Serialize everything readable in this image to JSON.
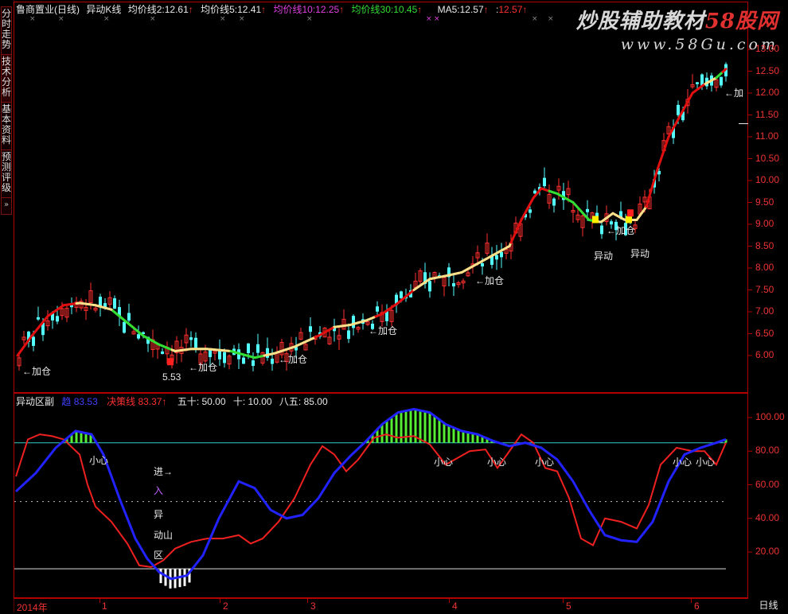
{
  "left_tabs": [
    {
      "label": "分时走势",
      "active": false
    },
    {
      "label": "技术分析",
      "active": true
    },
    {
      "label": "基本资料",
      "active": false
    },
    {
      "label": "预测评级",
      "active": false
    },
    {
      "label": "»",
      "active": false
    }
  ],
  "header": {
    "stock": "鲁商置业(日线)",
    "indicator": "异动K线",
    "ma2_label": "均价线2:",
    "ma2_value": "12.61",
    "ma5_label": "均价线5:",
    "ma5_value": "12.41",
    "ma10_label": "均价线10:",
    "ma10_value": "12.25",
    "ma30_label": "均价线30:",
    "ma30_value": "10.45",
    "ma5b_label": "MA5:",
    "ma5b_value": "12.57",
    "extra_value": "12.57",
    "arrow_glyph": "↑"
  },
  "watermark": {
    "line1a": "炒股辅助教材",
    "line1b": "58股网",
    "line2": "www.58Gu.com"
  },
  "price_axis": [
    "13.00",
    "12.50",
    "12.00",
    "11.50",
    "11.00",
    "10.50",
    "10.00",
    "9.50",
    "9.00",
    "8.50",
    "8.00",
    "7.50",
    "7.00",
    "6.50",
    "6.00"
  ],
  "price_annotations": {
    "add": "←加仓",
    "add_short": "←加",
    "low_value": "5.53",
    "anomaly": "异动"
  },
  "sub_header": {
    "name": "异动区副",
    "series1_label": "趋",
    "series1_value": "83.53",
    "series2_label": "决策线",
    "series2_value": "83.37",
    "fifty": "五十: 50.00",
    "ten": "十: 10.00",
    "eightyfive": "八五: 85.00"
  },
  "sub_axis": [
    "100.00",
    "80.00",
    "60.00",
    "40.00",
    "20.00"
  ],
  "sub_annotations": {
    "caution": "小心",
    "enter": "进→",
    "vertical": [
      "入",
      "异",
      "动山",
      "区"
    ]
  },
  "date_axis": [
    "2014年",
    "1",
    "2",
    "3",
    "4",
    "5",
    "6"
  ],
  "corner_label": "日线",
  "colors": {
    "up": "#ff3030",
    "down": "#54ffff",
    "ma_red": "#e01010",
    "ma_green": "#33dd33",
    "ma_yellow": "#ffe08a",
    "blue": "#2222ff",
    "sub_red": "#ee2020",
    "hist_green": "#55ee33",
    "hist_white": "#ffffff",
    "level85": "#33cccc"
  }
}
